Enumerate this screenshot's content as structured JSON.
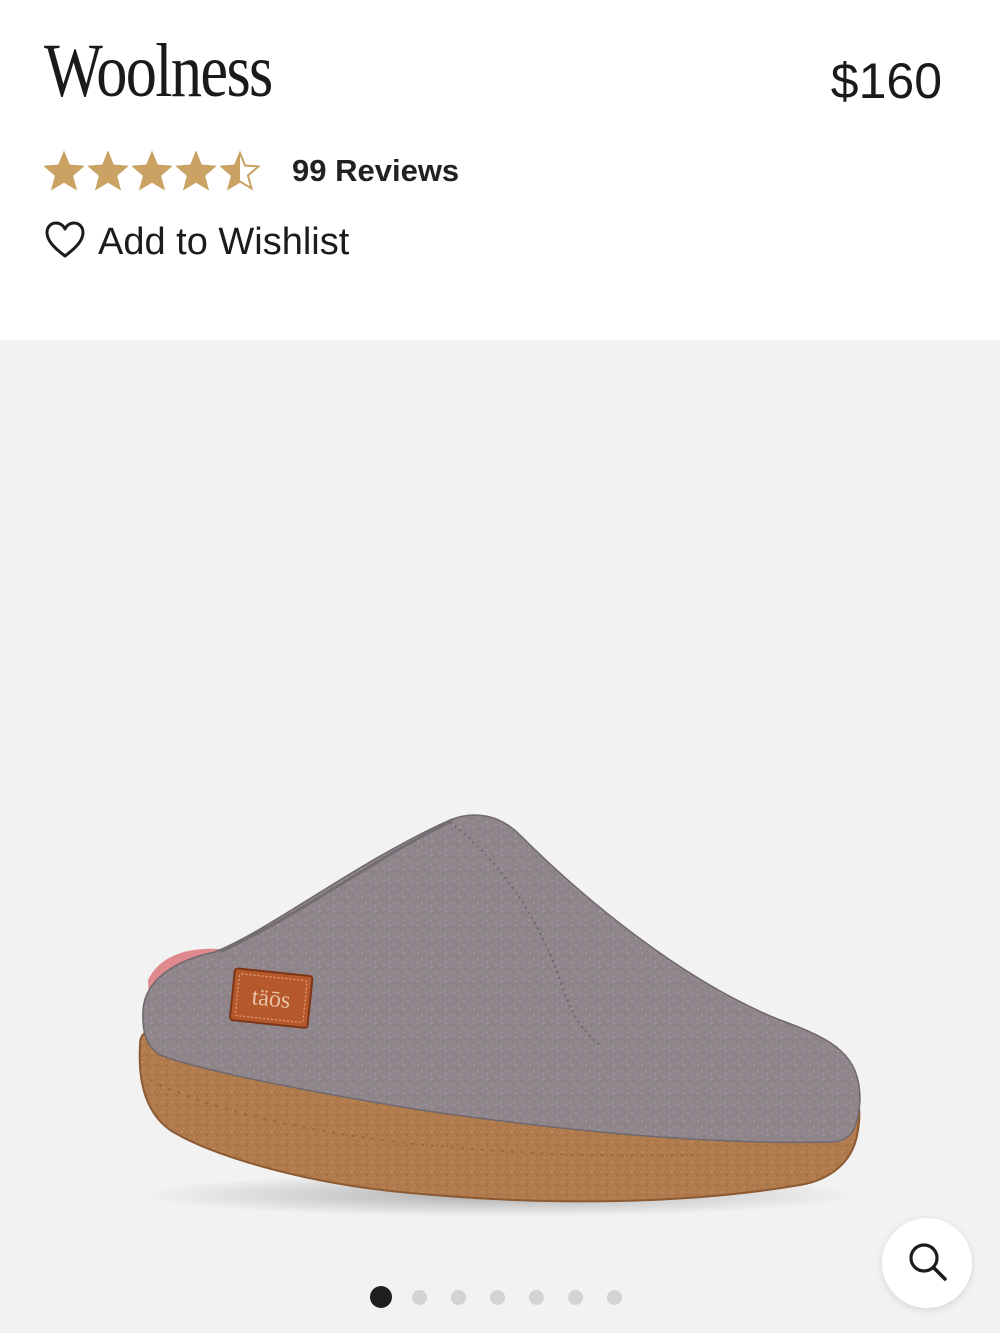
{
  "product": {
    "title": "Woolness",
    "price": "$160",
    "rating": 4.5,
    "rating_max": 5,
    "reviews_label": "99 Reviews",
    "wishlist_label": "Add to Wishlist",
    "brand_tag": "täōs"
  },
  "gallery": {
    "image_count": 7,
    "active_index": 0
  },
  "colors": {
    "star": "#c9a264",
    "background_gallery": "#f2f2f2",
    "felt": "#8f868b",
    "sole": "#b07a4c",
    "tag": "#b5582c",
    "lining": "#e08a8f",
    "active_dot": "#1e1e1e",
    "inactive_dot": "#d3d3d3"
  },
  "icons": {
    "wishlist": "heart-outline-icon",
    "zoom": "search-icon",
    "rating": "star-icon"
  }
}
